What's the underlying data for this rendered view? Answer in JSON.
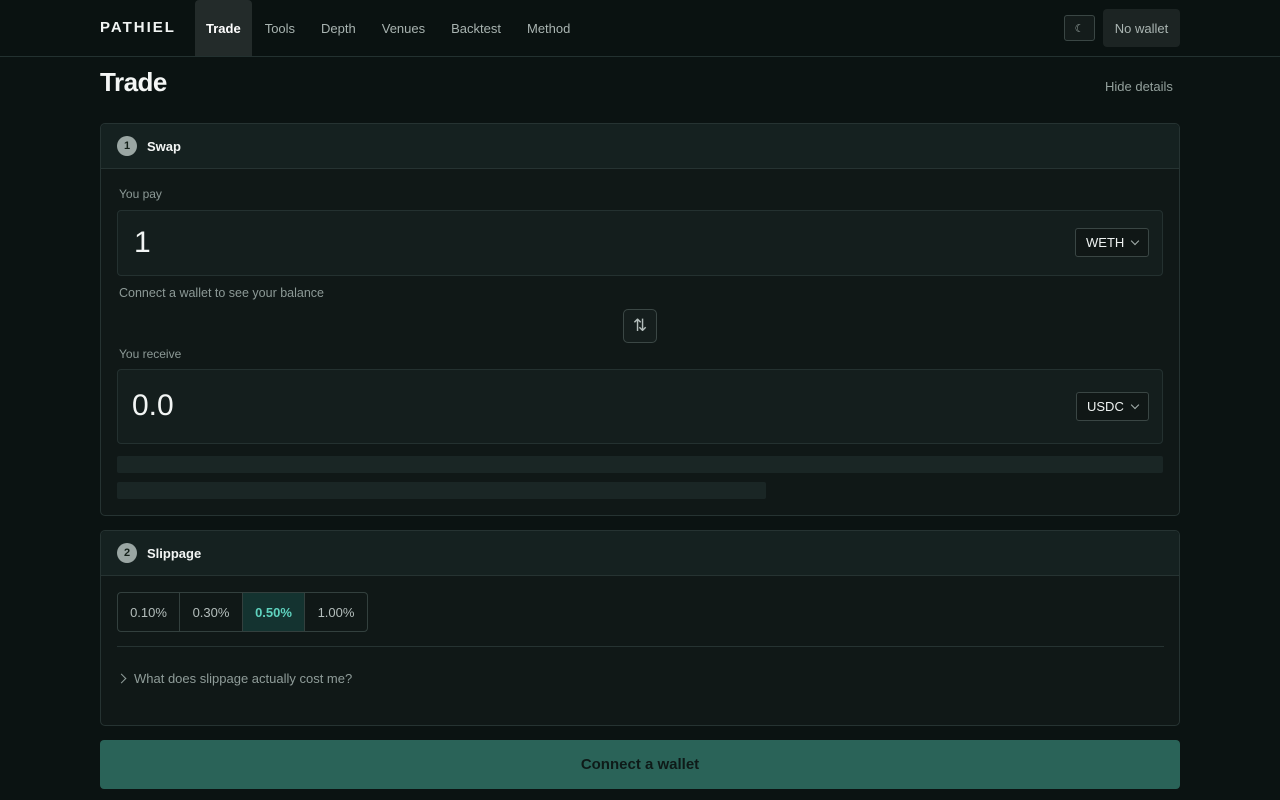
{
  "nav": {
    "brand": "PATHIEL",
    "items": [
      {
        "label": "Trade",
        "active": true
      },
      {
        "label": "Tools"
      },
      {
        "label": "Depth"
      },
      {
        "label": "Venues"
      },
      {
        "label": "Backtest"
      },
      {
        "label": "Method"
      }
    ],
    "theme_icon": "☾",
    "wallet_label": "No wallet"
  },
  "page": {
    "title": "Trade",
    "hide_details": "Hide details"
  },
  "swap": {
    "step": "1",
    "title": "Swap",
    "pay_label": "You pay",
    "pay_amount": "1",
    "pay_token": "WETH",
    "balance_hint": "Connect a wallet to see your balance",
    "swap_icon": "⇅",
    "receive_label": "You receive",
    "receive_amount": "0.0",
    "receive_token": "USDC"
  },
  "slippage": {
    "step": "2",
    "title": "Slippage",
    "options": [
      "0.10%",
      "0.30%",
      "0.50%",
      "1.00%"
    ],
    "selected": "0.50%",
    "question": "What does slippage actually cost me?"
  },
  "connect_label": "Connect a wallet",
  "colors": {
    "background": "#0b1312",
    "accent": "#5fd3bf",
    "cta": "#2a6358"
  }
}
